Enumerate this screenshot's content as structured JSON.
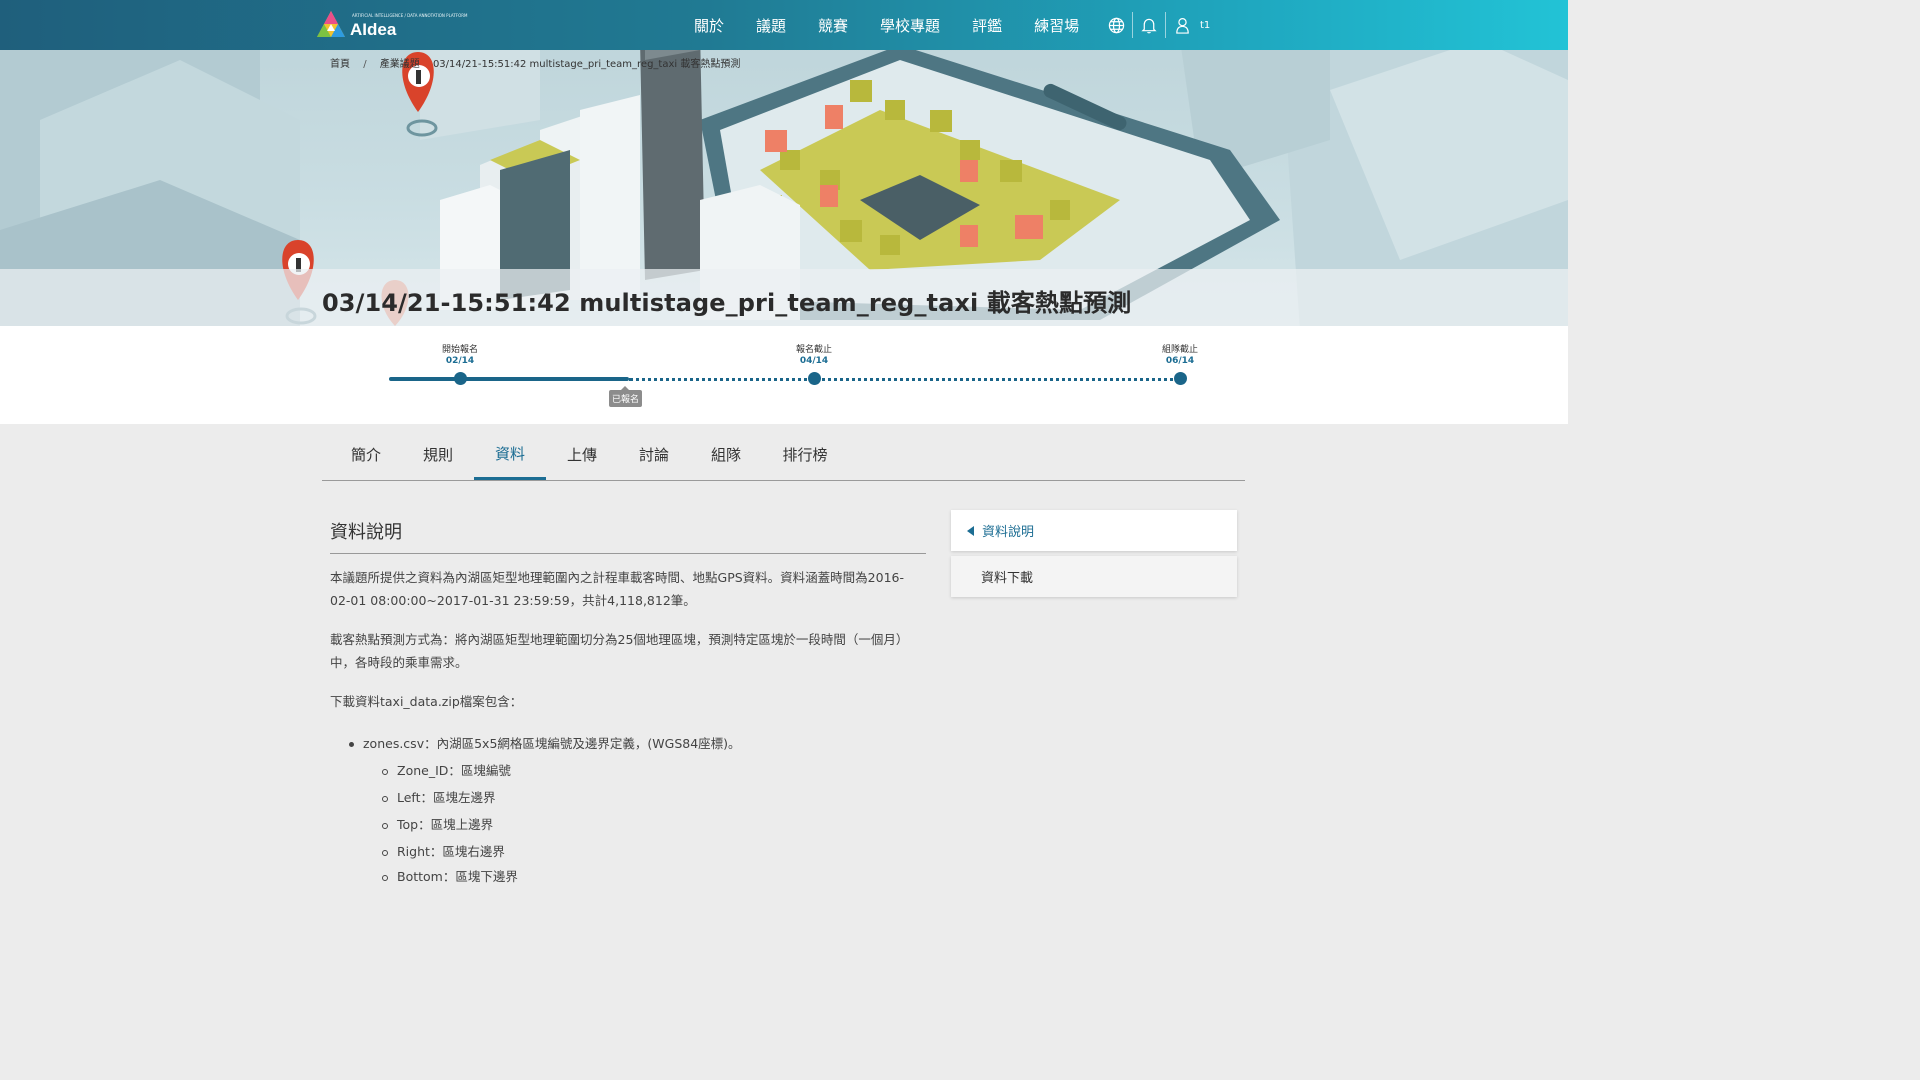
{
  "nav": {
    "logo_text": "AIdea",
    "logo_subtitle": "ARTIFICIAL INTELLIGENCE / DATA ANNOTATION PLATFORM",
    "items": [
      {
        "label": "關於"
      },
      {
        "label": "議題"
      },
      {
        "label": "競賽"
      },
      {
        "label": "學校專題"
      },
      {
        "label": "評鑑"
      },
      {
        "label": "練習場"
      }
    ],
    "user_name": "t1",
    "icons": [
      "globe-icon",
      "bell-icon",
      "user-icon"
    ]
  },
  "breadcrumb": {
    "home": "首頁",
    "separator": "/",
    "category": "產業議題",
    "current": "03/14/21-15:51:42 multistage_pri_team_reg_taxi 載客熱點預測"
  },
  "page_title": "03/14/21-15:51:42 multistage_pri_team_reg_taxi 載客熱點預測",
  "timeline": {
    "milestones": [
      {
        "label": "開始報名",
        "date": "02/14"
      },
      {
        "label": "報名截止",
        "date": "04/14"
      },
      {
        "label": "組隊截止",
        "date": "06/14"
      }
    ],
    "status": "已報名",
    "progress": 0.3
  },
  "tabs": [
    {
      "label": "簡介"
    },
    {
      "label": "規則"
    },
    {
      "label": "資料"
    },
    {
      "label": "上傳"
    },
    {
      "label": "討論"
    },
    {
      "label": "組隊"
    },
    {
      "label": "排行榜"
    }
  ],
  "active_tab": "資料",
  "content": {
    "section_title": "資料說明",
    "para1": "本議題所提供之資料為內湖區矩型地理範圍內之計程車載客時間、地點GPS資料。資料涵蓋時間為2016-02-01 08:00:00~2017-01-31 23:59:59，共計4,118,812筆。",
    "para2": "載客熱點預測方式為：將內湖區矩型地理範圍切分為25個地理區塊，預測特定區塊於一段時間（一個月）中，各時段的乘車需求。",
    "para3": "下載資料taxi_data.zip檔案包含：",
    "bullet1": "zones.csv：內湖區5x5網格區塊編號及邊界定義，(WGS84座標)。",
    "sub_bullets": [
      "Zone_ID：區塊編號",
      "Left：區塊左邊界",
      "Top：區塊上邊界",
      "Right：區塊右邊界",
      "Bottom：區塊下邊界"
    ]
  },
  "side_nav": {
    "items": [
      {
        "label": "資料說明"
      },
      {
        "label": "資料下載"
      }
    ]
  },
  "colors": {
    "accent": "#1c6d93",
    "nav_start": "#1f5f7c",
    "nav_end": "#22c3d6"
  }
}
